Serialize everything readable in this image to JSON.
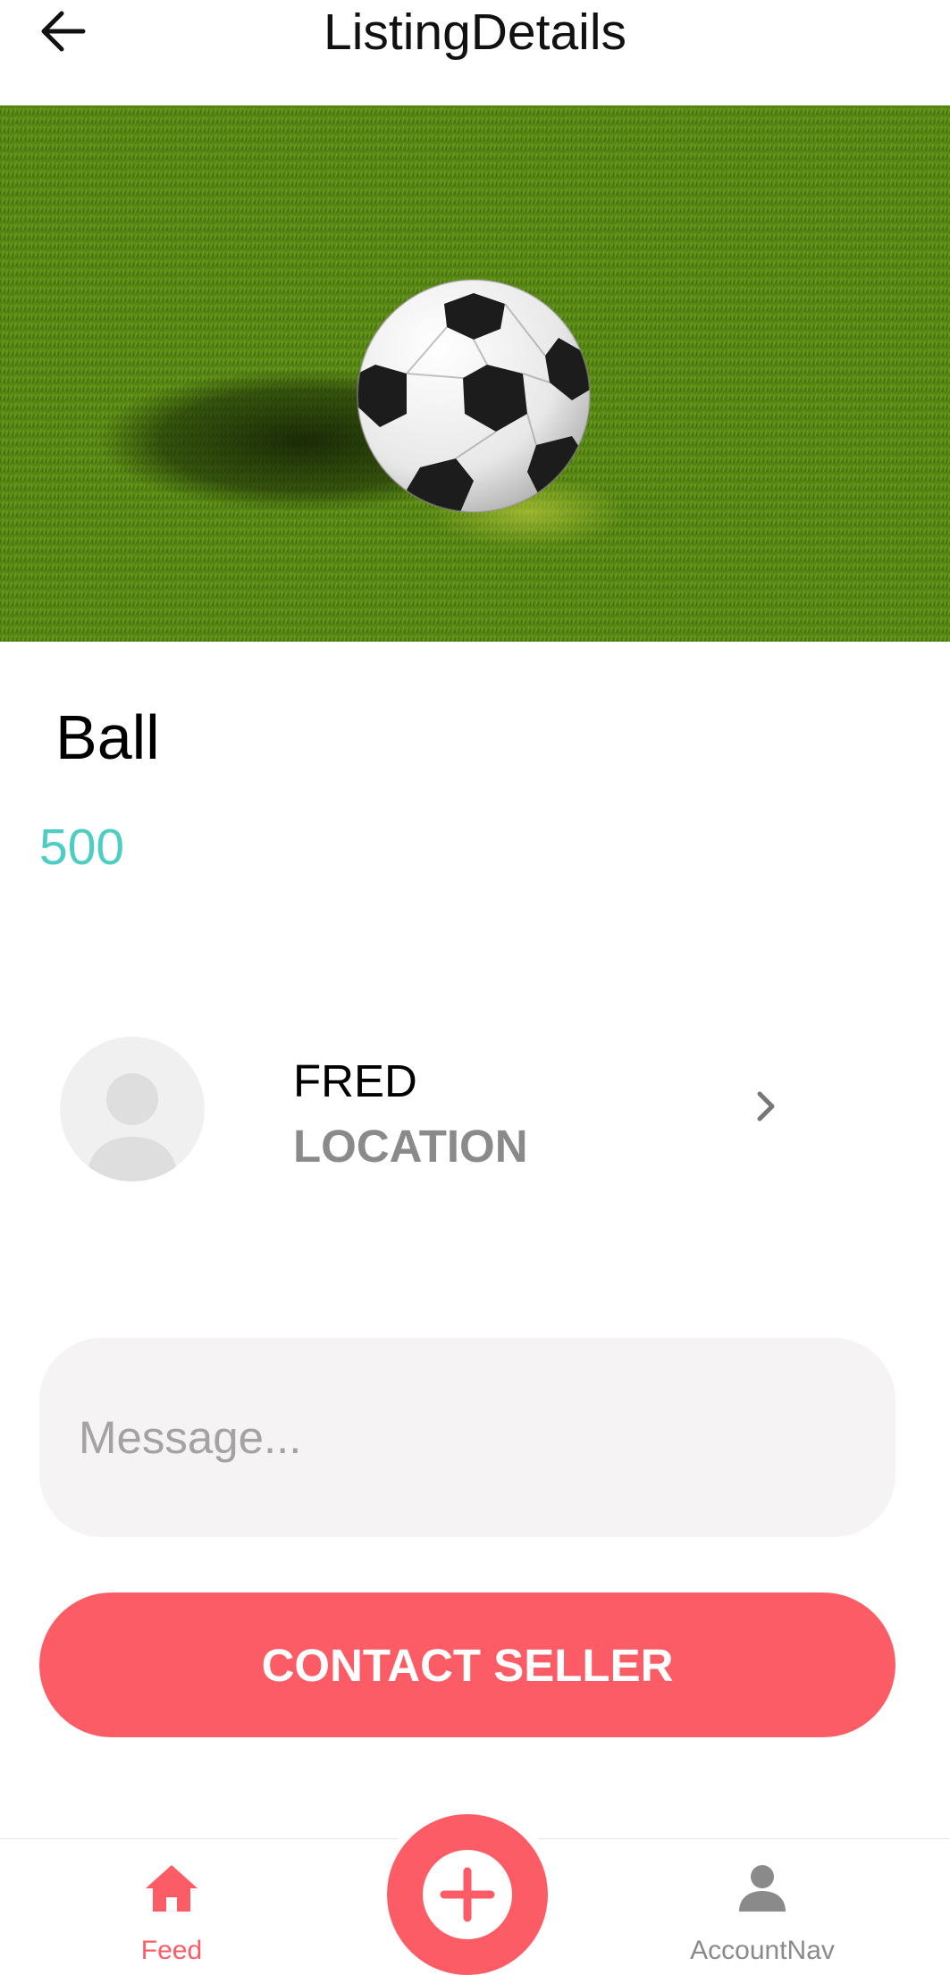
{
  "header": {
    "title": "ListingDetails",
    "back_icon": "arrow-left-icon"
  },
  "listing": {
    "image_description_icon": "soccer-ball-on-grass-photo",
    "title": "Ball",
    "price": "500"
  },
  "seller": {
    "avatar_icon": "user-avatar-icon",
    "name": "FRED",
    "location": "LOCATION",
    "chevron_icon": "chevron-right-icon"
  },
  "message": {
    "placeholder": "Message...",
    "value": ""
  },
  "contact_button": {
    "label": "CONTACT SELLER"
  },
  "bottom_nav": {
    "items": [
      {
        "label": "Feed",
        "icon": "home-icon",
        "active": true
      },
      {
        "label": "AccountNav",
        "icon": "person-icon",
        "active": false
      }
    ],
    "fab_icon": "plus-circle-icon"
  },
  "colors": {
    "primary": "#fc5c65",
    "secondary": "#4ecdc4",
    "medium": "#8a8a8a",
    "light": "#f5f3f3",
    "inactive_nav": "#8a8a8a"
  }
}
